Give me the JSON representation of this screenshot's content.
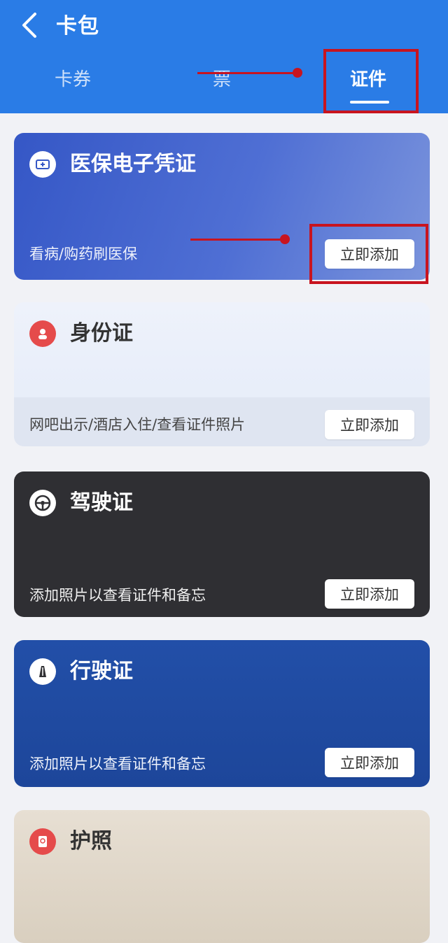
{
  "header": {
    "title": "卡包",
    "tabs": [
      {
        "label": "卡券"
      },
      {
        "label": "票"
      },
      {
        "label": "证件"
      }
    ]
  },
  "cards": [
    {
      "name": "医保电子凭证",
      "desc": "看病/购药刷医保",
      "button": "立即添加"
    },
    {
      "name": "身份证",
      "desc": "网吧出示/酒店入住/查看证件照片",
      "button": "立即添加"
    },
    {
      "name": "驾驶证",
      "desc": "添加照片以查看证件和备忘",
      "button": "立即添加"
    },
    {
      "name": "行驶证",
      "desc": "添加照片以查看证件和备忘",
      "button": "立即添加"
    },
    {
      "name": "护照"
    }
  ],
  "colors": {
    "header_bg": "#2a7ce6",
    "annotation": "#c8141f",
    "medical_card": "#3557c6",
    "driver_card": "#2f2f33",
    "vehicle_card": "#224fa8",
    "id_icon": "#e54b4b"
  },
  "icons": {
    "back": "chevron-left-icon",
    "medical": "medical-insurance-icon",
    "idcard": "id-card-icon",
    "driver": "steering-wheel-icon",
    "vehicle": "car-icon",
    "passport": "passport-icon"
  }
}
